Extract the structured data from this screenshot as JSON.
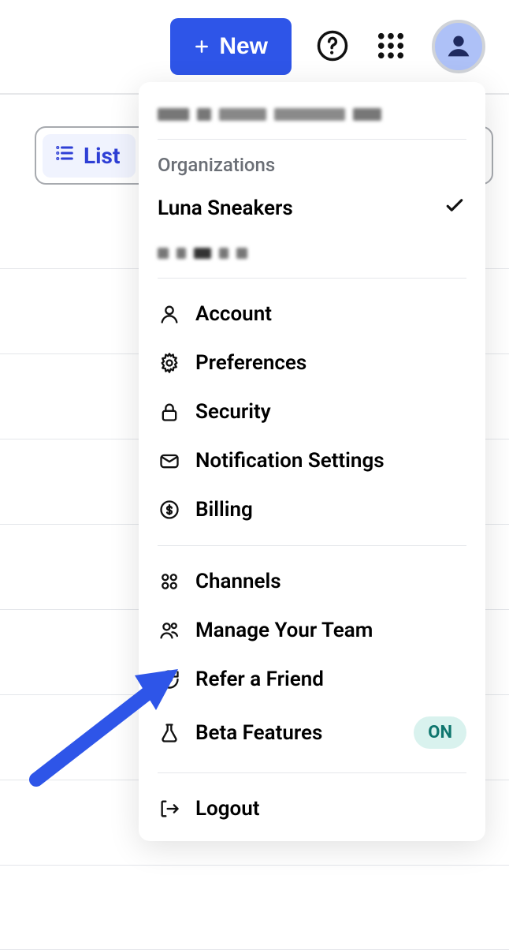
{
  "toolbar": {
    "new_label": "New"
  },
  "view": {
    "list_label": "List"
  },
  "dropdown": {
    "orgs_heading": "Organizations",
    "orgs": [
      {
        "name": "Luna Sneakers",
        "selected": true
      }
    ],
    "items_group1": [
      {
        "icon": "account",
        "label": "Account"
      },
      {
        "icon": "preferences",
        "label": "Preferences"
      },
      {
        "icon": "security",
        "label": "Security"
      },
      {
        "icon": "notification",
        "label": "Notification Settings"
      },
      {
        "icon": "billing",
        "label": "Billing"
      }
    ],
    "items_group2": [
      {
        "icon": "channels",
        "label": "Channels"
      },
      {
        "icon": "team",
        "label": "Manage Your Team"
      },
      {
        "icon": "refer",
        "label": "Refer a Friend"
      },
      {
        "icon": "beta",
        "label": "Beta Features",
        "pill": "ON"
      }
    ],
    "logout_label": "Logout"
  },
  "colors": {
    "primary": "#2e55e8",
    "avatar_bg": "#aec1f7",
    "beta_pill_bg": "#d9f2ee"
  }
}
